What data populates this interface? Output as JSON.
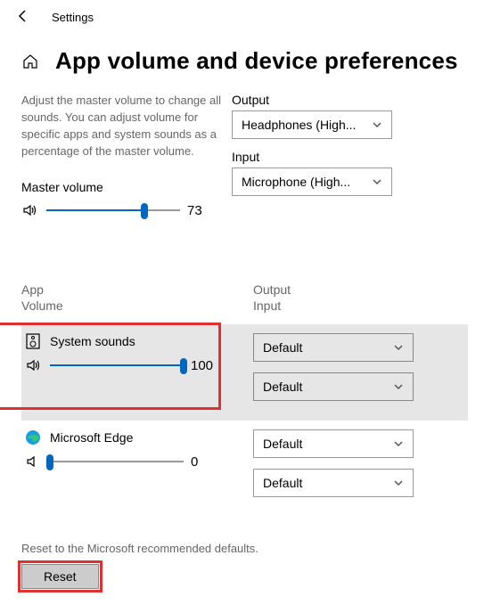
{
  "header": {
    "app_name": "Settings",
    "page_title": "App volume and device preferences"
  },
  "description": "Adjust the master volume to change all sounds. You can adjust volume for specific apps and system sounds as a percentage of the master volume.",
  "master": {
    "label": "Master volume",
    "value": "73",
    "percent": 73
  },
  "output": {
    "label": "Output",
    "selected": "Headphones (High..."
  },
  "input": {
    "label": "Input",
    "selected": "Microphone (High..."
  },
  "columns": {
    "left_line1": "App",
    "left_line2": "Volume",
    "right_line1": "Output",
    "right_line2": "Input"
  },
  "apps": [
    {
      "name": "System sounds",
      "volume": "100",
      "percent": 100,
      "output": "Default",
      "input": "Default",
      "icon": "system",
      "selected": true
    },
    {
      "name": "Microsoft Edge",
      "volume": "0",
      "percent": 0,
      "output": "Default",
      "input": "Default",
      "icon": "edge",
      "selected": false
    }
  ],
  "reset": {
    "text": "Reset to the Microsoft recommended defaults.",
    "button": "Reset"
  }
}
